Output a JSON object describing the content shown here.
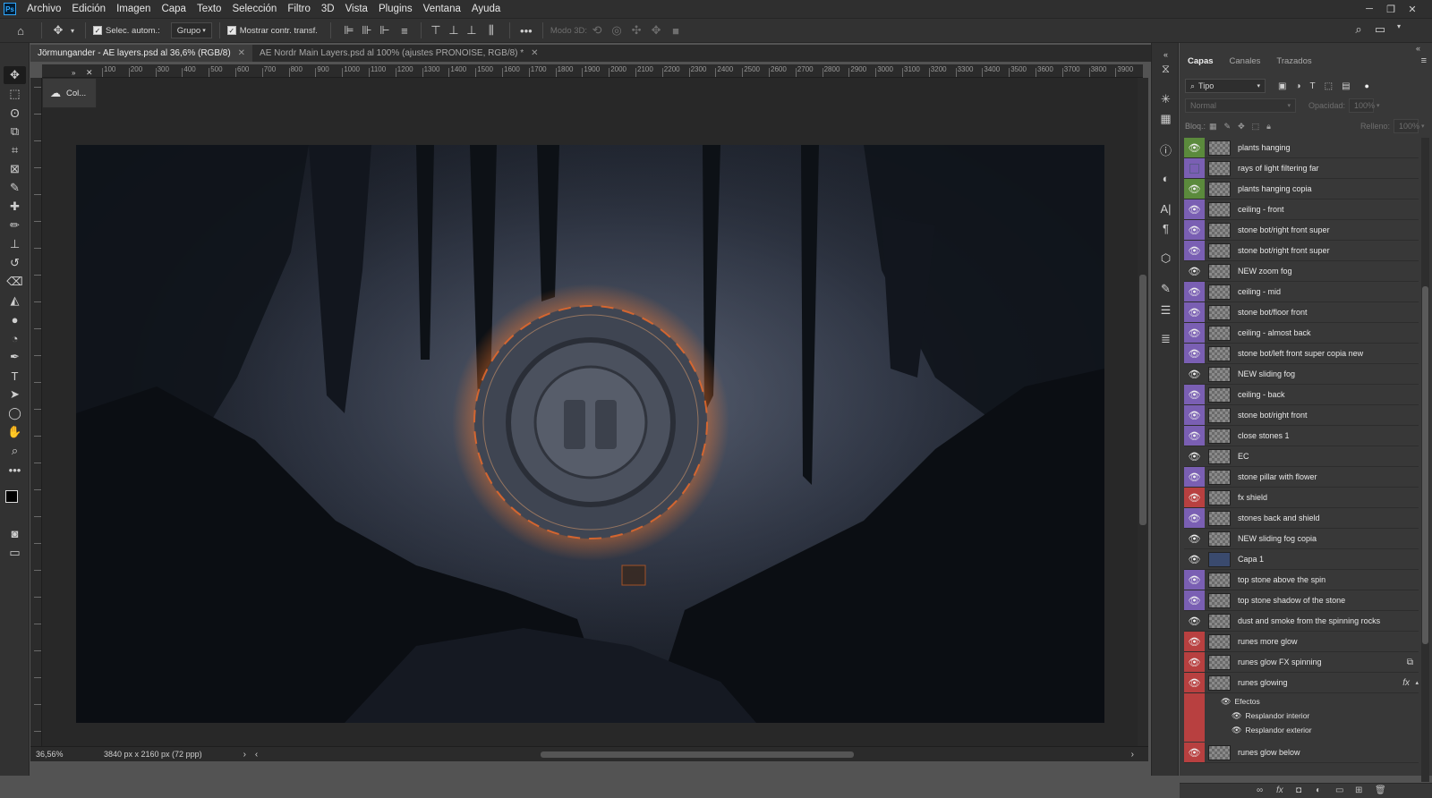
{
  "app": {
    "logo": "Ps"
  },
  "menu": [
    "Archivo",
    "Edición",
    "Imagen",
    "Capa",
    "Texto",
    "Selección",
    "Filtro",
    "3D",
    "Vista",
    "Plugins",
    "Ventana",
    "Ayuda"
  ],
  "options": {
    "auto_select_label": "Selec. autom.:",
    "group_select": "Grupo",
    "show_transform_label": "Mostrar contr. transf.",
    "mode3d_label": "Modo 3D:"
  },
  "tabs": [
    {
      "label": "Jörmungander - AE layers.psd al 36,6% (RGB/8)",
      "active": true
    },
    {
      "label": "AE Nordr Main Layers.psd al 100% (ajustes PRONOISE, RGB/8) *",
      "active": false
    }
  ],
  "ruler_h": [
    "100",
    "200",
    "300",
    "400",
    "500",
    "600",
    "700",
    "800",
    "900",
    "1000",
    "1100",
    "1200",
    "1300",
    "1400",
    "1500",
    "1600",
    "1700",
    "1800",
    "1900",
    "2000",
    "2100",
    "2200",
    "2300",
    "2400",
    "2500",
    "2600",
    "2700",
    "2800",
    "2900",
    "3000",
    "3100",
    "3200",
    "3300",
    "3400",
    "3500",
    "3600",
    "3700",
    "3800",
    "3900"
  ],
  "collapsed_panel": {
    "label": "Col..."
  },
  "status": {
    "zoom": "36,56%",
    "doc_info": "3840 px x 2160 px (72 ppp)"
  },
  "panel": {
    "tabs": [
      "Capas",
      "Canales",
      "Trazados"
    ],
    "filter": "Tipo",
    "blend_mode": "Normal",
    "opacity_label": "Opacidad:",
    "opacity_value": "100%",
    "lock_label": "Bloq.:",
    "fill_label": "Relleno:",
    "fill_value": "100%"
  },
  "layers": [
    {
      "name": "plants hanging",
      "color": "#5b8a3c"
    },
    {
      "name": "rays of light filtering far",
      "color": "#7a5fb3",
      "hidden": true
    },
    {
      "name": "plants hanging copia",
      "color": "#5b8a3c"
    },
    {
      "name": "ceiling - front",
      "color": "#7a5fb3"
    },
    {
      "name": "stone bot/right front super",
      "color": "#7a5fb3"
    },
    {
      "name": "stone bot/right front super",
      "color": "#7a5fb3"
    },
    {
      "name": "NEW zoom fog",
      "color": "#383838"
    },
    {
      "name": "ceiling - mid",
      "color": "#7a5fb3"
    },
    {
      "name": "stone bot/floor front",
      "color": "#7a5fb3"
    },
    {
      "name": "ceiling - almost back",
      "color": "#7a5fb3"
    },
    {
      "name": "stone bot/left front super copia new",
      "color": "#7a5fb3"
    },
    {
      "name": "NEW sliding fog",
      "color": "#383838"
    },
    {
      "name": "ceiling - back",
      "color": "#7a5fb3"
    },
    {
      "name": "stone bot/right front",
      "color": "#7a5fb3"
    },
    {
      "name": "close stones 1",
      "color": "#7a5fb3"
    },
    {
      "name": "EC",
      "color": "#383838"
    },
    {
      "name": "stone pillar with flower",
      "color": "#7a5fb3"
    },
    {
      "name": "fx shield",
      "color": "#b84040"
    },
    {
      "name": "stones back and shield",
      "color": "#7a5fb3"
    },
    {
      "name": "NEW sliding fog copia",
      "color": "#383838"
    },
    {
      "name": "Capa 1",
      "color": "#383838"
    },
    {
      "name": "top stone above the spin",
      "color": "#7a5fb3"
    },
    {
      "name": "top stone shadow of the stone",
      "color": "#7a5fb3"
    },
    {
      "name": "dust and smoke from the spinning rocks",
      "color": "#383838"
    },
    {
      "name": "runes more glow",
      "color": "#b84040"
    },
    {
      "name": "runes glow FX spinning",
      "color": "#b84040"
    },
    {
      "name": "runes glowing",
      "color": "#b84040",
      "fx": "fx"
    }
  ],
  "effects": {
    "header": "Efectos",
    "items": [
      "Resplandor interior",
      "Resplandor exterior"
    ]
  },
  "layer_partial": "runes glow below"
}
